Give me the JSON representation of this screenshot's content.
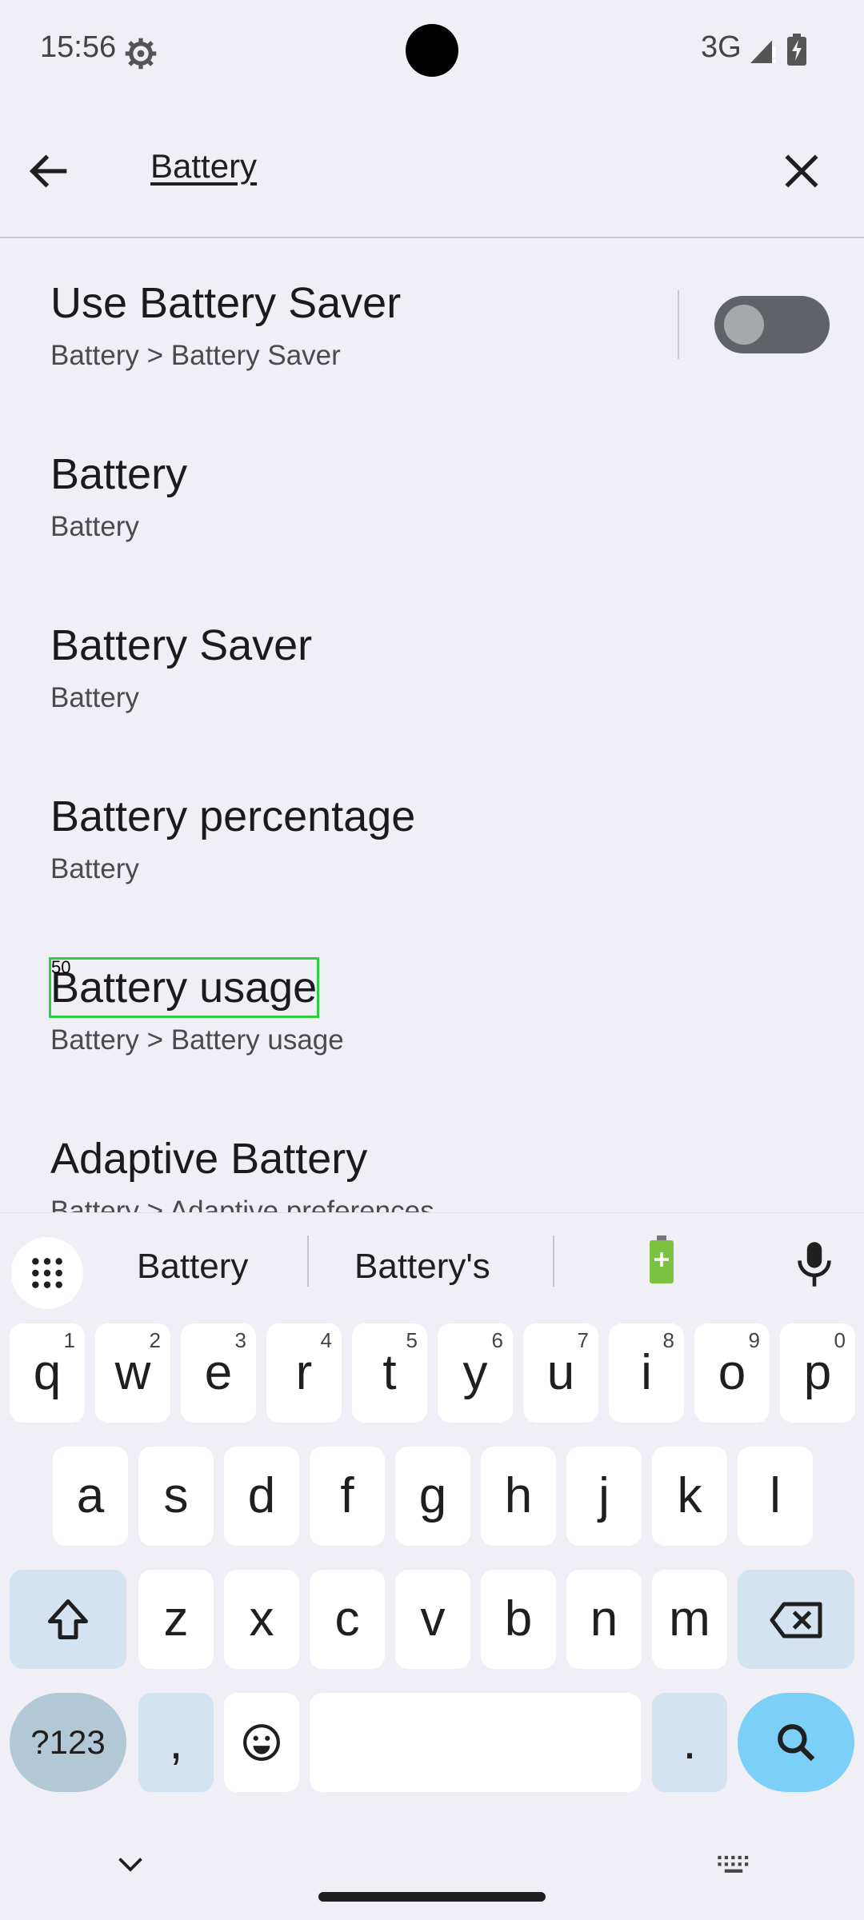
{
  "status_bar": {
    "time": "15:56",
    "network": "3G"
  },
  "search": {
    "query": "Battery"
  },
  "results": [
    {
      "title": "Use Battery Saver",
      "subtitle": "Battery > Battery Saver",
      "toggle": false
    },
    {
      "title": "Battery",
      "subtitle": "Battery"
    },
    {
      "title": "Battery Saver",
      "subtitle": "Battery"
    },
    {
      "title": "Battery percentage",
      "subtitle": "Battery"
    },
    {
      "title": "Battery usage",
      "subtitle": "Battery > Battery usage"
    },
    {
      "title": "Adaptive Battery",
      "subtitle": "Battery > Adaptive preferences"
    }
  ],
  "highlight_label": "50",
  "keyboard": {
    "suggestions": [
      "Battery",
      "Battery's"
    ],
    "row1": [
      {
        "k": "q",
        "h": "1"
      },
      {
        "k": "w",
        "h": "2"
      },
      {
        "k": "e",
        "h": "3"
      },
      {
        "k": "r",
        "h": "4"
      },
      {
        "k": "t",
        "h": "5"
      },
      {
        "k": "y",
        "h": "6"
      },
      {
        "k": "u",
        "h": "7"
      },
      {
        "k": "i",
        "h": "8"
      },
      {
        "k": "o",
        "h": "9"
      },
      {
        "k": "p",
        "h": "0"
      }
    ],
    "row2": [
      "a",
      "s",
      "d",
      "f",
      "g",
      "h",
      "j",
      "k",
      "l"
    ],
    "row3": [
      "z",
      "x",
      "c",
      "v",
      "b",
      "n",
      "m"
    ],
    "symbols_label": "?123",
    "comma": ",",
    "period": "."
  }
}
